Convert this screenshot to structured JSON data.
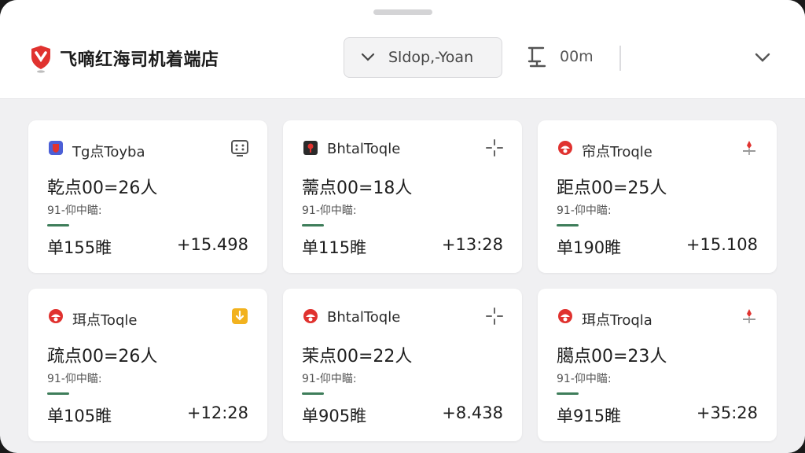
{
  "header": {
    "title": "飞嘀红海司机着端店",
    "dropdown_value": "Sldop,-Yoan",
    "distance_label": "00m"
  },
  "cards": [
    {
      "icon": "blue-badge-icon",
      "name": "Tg点Toyba",
      "action_icon": "device-icon",
      "time": "乾点00=26人",
      "sub": "91-仰中瞄:",
      "left": "单155睢",
      "right": "+15.498"
    },
    {
      "icon": "black-pin-icon",
      "name": "BhtalToqle",
      "action_icon": "crosshair-icon",
      "time": "薷点00=18人",
      "sub": "91-仰中瞄:",
      "left": "单115睢",
      "right": "+13:28"
    },
    {
      "icon": "red-helmet-icon",
      "name": "帘点Troqle",
      "action_icon": "red-pin-icon",
      "time": "距点00=25人",
      "sub": "91-仰中瞄:",
      "left": "单190睢",
      "right": "+15.108"
    },
    {
      "icon": "red-helmet-icon",
      "name": "珥点Toqle",
      "action_icon": "yellow-badge-icon",
      "time": "疏点00=26人",
      "sub": "91-仰中瞄:",
      "left": "单105睢",
      "right": "+12:28"
    },
    {
      "icon": "red-helmet-icon",
      "name": "BhtalToqle",
      "action_icon": "crosshair-icon",
      "time": "茉点00=22人",
      "sub": "91-仰中瞄:",
      "left": "单905睢",
      "right": "+8.438"
    },
    {
      "icon": "red-helmet-icon",
      "name": "珥点Troqla",
      "action_icon": "red-pin-icon",
      "time": "臈点00=23人",
      "sub": "91-仰中瞄:",
      "left": "单915睢",
      "right": "+35:28"
    }
  ],
  "colors": {
    "brand_red": "#e0322f",
    "accent_green": "#3e7d5a",
    "badge_blue": "#4b5fd6",
    "badge_yellow": "#f2b21e",
    "background": "#f0f0f2"
  }
}
